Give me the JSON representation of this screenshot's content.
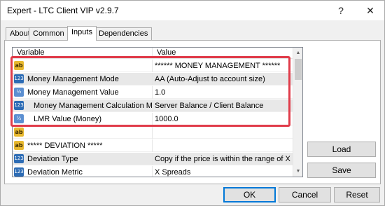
{
  "window": {
    "title": "Expert - LTC Client VIP v2.9.7",
    "help_label": "?",
    "close_label": "✕"
  },
  "tabs": [
    {
      "label": "About",
      "active": false
    },
    {
      "label": "Common",
      "active": false
    },
    {
      "label": "Inputs",
      "active": true
    },
    {
      "label": "Dependencies",
      "active": false
    }
  ],
  "grid": {
    "columns": {
      "variable": "Variable",
      "value": "Value"
    },
    "rows": [
      {
        "icon": "string-icon",
        "variable": "",
        "value": "****** MONEY MANAGEMENT ******"
      },
      {
        "icon": "integer-icon",
        "variable": "Money Management Mode",
        "value": "AA (Auto-Adjust to account size)"
      },
      {
        "icon": "double-icon",
        "variable": "Money Management Value",
        "value": "1.0"
      },
      {
        "icon": "integer-icon",
        "variable": "Money Management Calculation M...",
        "value": "Server Balance / Client Balance"
      },
      {
        "icon": "double-icon",
        "variable": "LMR Value (Money)",
        "value": "1000.0"
      },
      {
        "icon": "string-icon",
        "variable": "",
        "value": ""
      },
      {
        "icon": "string-icon",
        "variable": "***** DEVIATION *****",
        "value": ""
      },
      {
        "icon": "integer-icon",
        "variable": "Deviation Type",
        "value": "Copy if the price is within the range of X"
      },
      {
        "icon": "integer-icon",
        "variable": "Deviation Metric",
        "value": "X Spreads"
      }
    ],
    "icon_glyphs": {
      "string": "ab",
      "integer": "123",
      "double": "½"
    }
  },
  "buttons": {
    "load": "Load",
    "save": "Save",
    "ok": "OK",
    "cancel": "Cancel",
    "reset": "Reset"
  },
  "colors": {
    "highlight": "#e03c4a",
    "accent": "#0078d7"
  }
}
